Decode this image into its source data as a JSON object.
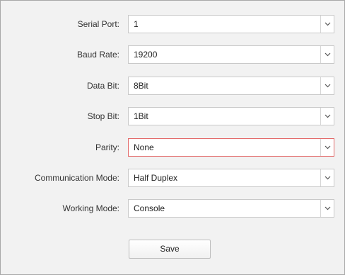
{
  "form": {
    "fields": [
      {
        "label": "Serial Port:",
        "value": "1"
      },
      {
        "label": "Baud Rate:",
        "value": "19200"
      },
      {
        "label": "Data Bit:",
        "value": "8Bit"
      },
      {
        "label": "Stop Bit:",
        "value": "1Bit"
      },
      {
        "label": "Parity:",
        "value": "None"
      },
      {
        "label": "Communication Mode:",
        "value": "Half Duplex"
      },
      {
        "label": "Working Mode:",
        "value": "Console"
      }
    ],
    "save_label": "Save"
  },
  "icons": {
    "dropdown": "chevron-down-icon"
  },
  "colors": {
    "focus_border": "#e36a6a",
    "panel_bg": "#f2f2f2"
  }
}
